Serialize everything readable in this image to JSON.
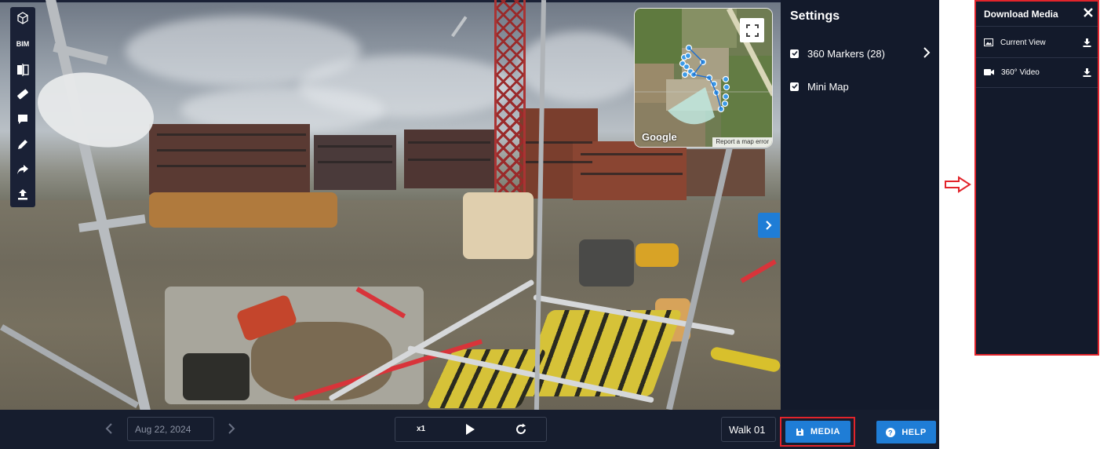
{
  "toolbar": {
    "bim_label": "BIM",
    "tools": [
      "compare-icon",
      "measure-icon",
      "comment-icon",
      "pencil-icon",
      "share-icon",
      "upload-icon"
    ]
  },
  "minimap": {
    "google_label": "Google",
    "report_label": "Report a map error"
  },
  "settings": {
    "title": "Settings",
    "items": [
      {
        "label": "360 Markers (28)",
        "checked": true
      },
      {
        "label": "Mini Map",
        "checked": true
      }
    ]
  },
  "bottom_bar": {
    "date": "Aug 22, 2024",
    "speed": "x1",
    "walk": "Walk 01",
    "media_label": "MEDIA",
    "help_label": "HELP"
  },
  "download_media": {
    "title": "Download Media",
    "items": [
      {
        "label": "Current View",
        "icon": "image-icon"
      },
      {
        "label": "360° Video",
        "icon": "video-icon"
      }
    ]
  },
  "colors": {
    "panel_bg": "#131a2b",
    "accent_blue": "#1f7dd6",
    "highlight_red": "#e2242b"
  }
}
